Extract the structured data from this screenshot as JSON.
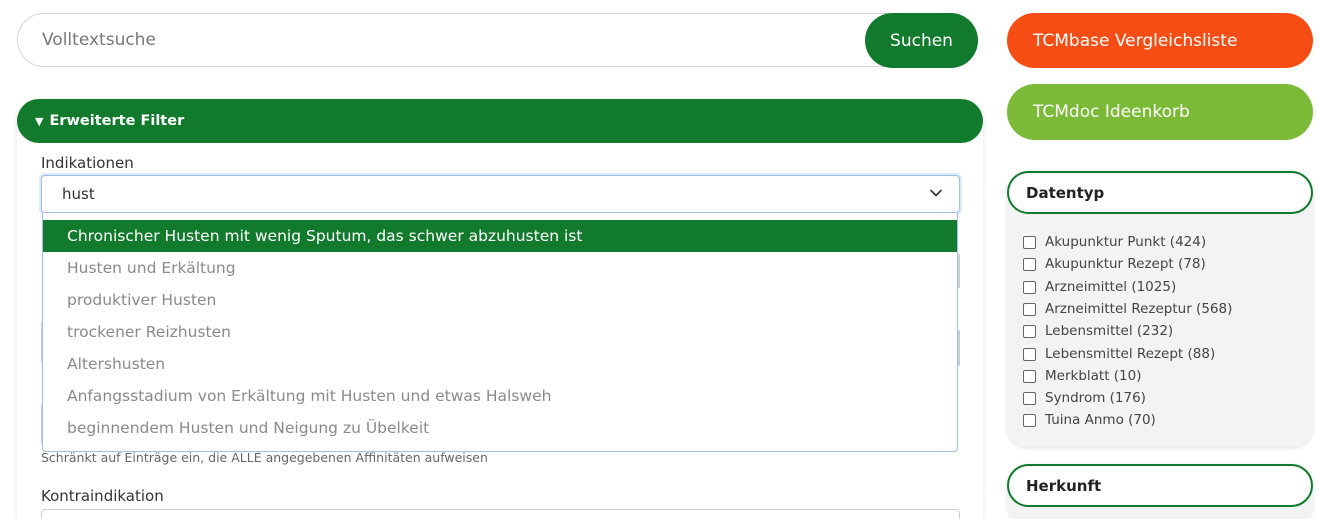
{
  "search": {
    "placeholder": "Volltextsuche",
    "button_label": "Suchen"
  },
  "filter": {
    "header_label": "Erweiterte Filter",
    "indikationen_label": "Indikationen",
    "indikationen_value": "hust",
    "dropdown_options": [
      "Chronischer Husten mit wenig Sputum, das schwer abzuhusten ist",
      "Husten und Erkältung",
      "produktiver Husten",
      "trockener Reizhusten",
      "Altershusten",
      "Anfangsstadium von Erkältung mit Husten und etwas Halsweh",
      "beginnendem Husten und Neigung zu Übelkeit"
    ],
    "dropdown_highlighted": "Chronischer Husten mit wenig Sputum, das schwer abzuhusten ist",
    "affinity_hint": "Schränkt auf Einträge ein, die ALLE angegebenen Affinitäten aufweisen",
    "kontraindikation_label": "Kontraindikation"
  },
  "right": {
    "vergleichsliste_label": "TCMbase Vergleichsliste",
    "ideenkorb_label": "TCMdoc Ideenkorb",
    "datentyp": {
      "title": "Datentyp",
      "items": [
        "Akupunktur Punkt (424)",
        "Akupunktur Rezept (78)",
        "Arzneimittel (1025)",
        "Arzneimittel Rezeptur (568)",
        "Lebensmittel (232)",
        "Lebensmittel Rezept (88)",
        "Merkblatt (10)",
        "Syndrom (176)",
        "Tuina Anmo (70)"
      ]
    },
    "herkunft": {
      "title": "Herkunft"
    }
  },
  "colors": {
    "green": "#117a2c",
    "orange": "#f64d14",
    "lime": "#7aba37",
    "focus_border": "#9cbfe8"
  },
  "icons": {
    "select_chevron": "chevron-down-icon",
    "filter_toggle": "triangle-down-icon"
  }
}
